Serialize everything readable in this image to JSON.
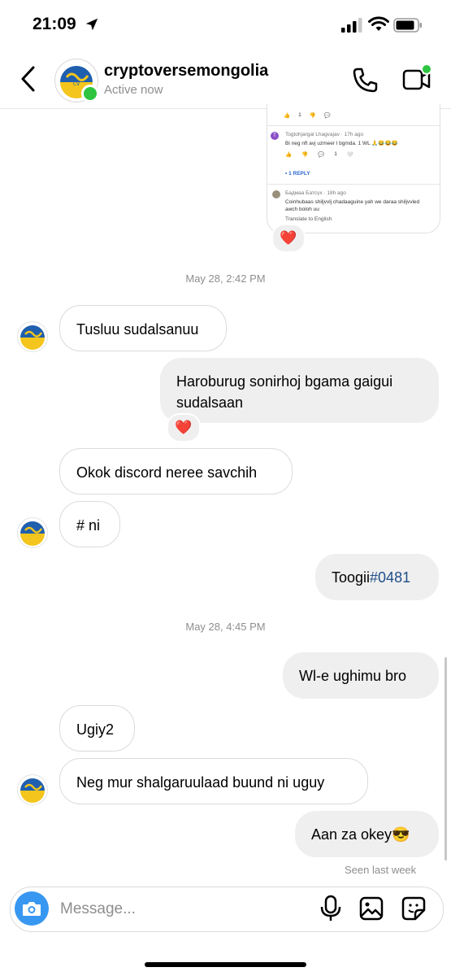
{
  "status_bar": {
    "time": "21:09"
  },
  "header": {
    "username": "cryptoversemongolia",
    "status": "Active now"
  },
  "shared_post": {
    "reactions_top": "1",
    "comment1_author": "Togtohjargal Lhagvajav · 17h ago",
    "comment1_text": "Bi neg nft avj uzmeer l bgmda. 1 WL 🙏😂😂😂",
    "comment1_count": "1",
    "reply_label": "• 1 REPLY",
    "comment2_author": "Бадмаа Батсүх · 18h ago",
    "comment2_text": "Coinhubaas shiljvvlj chadaaguine yah we daraa shiljvvled awch boloh uu",
    "translate": "Translate to English"
  },
  "timestamps": {
    "first": "May 28, 2:42 PM",
    "second": "May 28, 4:45 PM"
  },
  "messages": {
    "m1": "Tusluu sudalsanuu",
    "m2": "Haroburug sonirhoj bgama gaigui sudalsaan",
    "m3": "Okok discord neree savchih",
    "m4": "# ni",
    "m5_prefix": "Toogii",
    "m5_link": "#0481",
    "m6": "Wl-e ughimu bro",
    "m7": "Ugiy2",
    "m8": "Neg mur shalgaruulaad buund ni uguy",
    "m9": "Aan za okey😎"
  },
  "reactions": {
    "heart": "❤️"
  },
  "seen": "Seen last week",
  "composer": {
    "placeholder": "Message..."
  },
  "icons": {
    "location": "location-arrow-icon",
    "signal": "signal-icon",
    "wifi": "wifi-icon",
    "battery": "battery-icon",
    "back": "back-chevron-icon",
    "call": "phone-icon",
    "video": "video-icon",
    "camera": "camera-icon",
    "mic": "microphone-icon",
    "gallery": "gallery-icon",
    "sticker": "sticker-icon"
  },
  "colors": {
    "online": "#2ec43f",
    "camera": "#3897f0",
    "link": "#1f4f8a"
  }
}
